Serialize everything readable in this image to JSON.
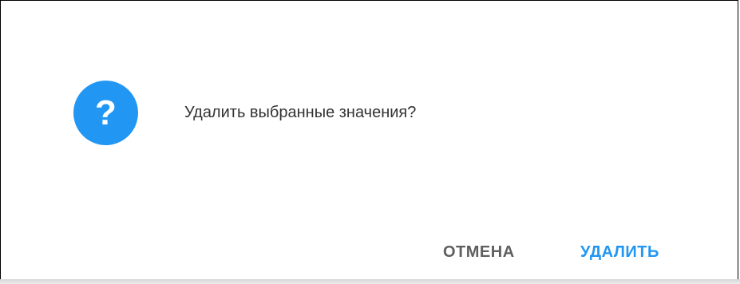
{
  "dialog": {
    "icon": "question-icon",
    "icon_glyph": "?",
    "message": "Удалить выбранные значения?",
    "buttons": {
      "cancel_label": "ОТМЕНА",
      "delete_label": "УДАЛИТЬ"
    }
  },
  "colors": {
    "accent": "#2196f3",
    "text": "#333333",
    "secondary_button": "#5f5f5f"
  }
}
